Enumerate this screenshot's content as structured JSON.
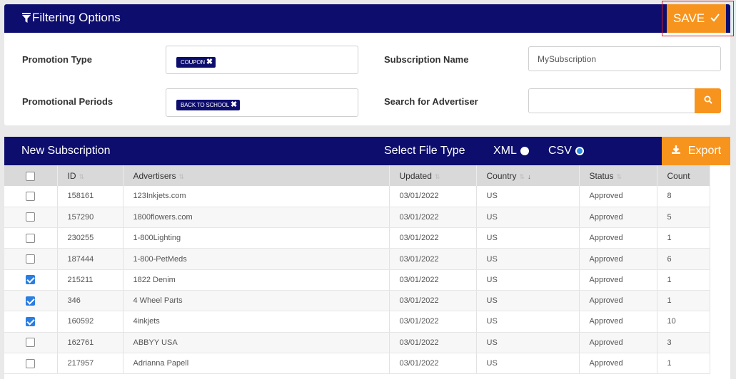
{
  "filter": {
    "title": "Filtering Options",
    "save_label": "SAVE",
    "promotion_type_label": "Promotion Type",
    "promotion_type_tags": [
      "COUPON"
    ],
    "promotional_periods_label": "Promotional Periods",
    "promotional_period_tags": [
      "BACK TO SCHOOL"
    ],
    "subscription_name_label": "Subscription Name",
    "subscription_name_value": "MySubscription",
    "search_advertiser_label": "Search for Advertiser",
    "search_advertiser_value": ""
  },
  "subscription": {
    "title": "New Subscription",
    "file_type_label": "Select File Type",
    "file_types": [
      {
        "label": "XML",
        "selected": false
      },
      {
        "label": "CSV",
        "selected": true
      }
    ],
    "export_label": "Export"
  },
  "table": {
    "columns": [
      "ID",
      "Advertisers",
      "Updated",
      "Country",
      "Status",
      "Count"
    ],
    "sorted_column": "Country",
    "rows": [
      {
        "checked": false,
        "id": "158161",
        "advertiser": "123Inkjets.com",
        "updated": "03/01/2022",
        "country": "US",
        "status": "Approved",
        "count": "8"
      },
      {
        "checked": false,
        "id": "157290",
        "advertiser": "1800flowers.com",
        "updated": "03/01/2022",
        "country": "US",
        "status": "Approved",
        "count": "5"
      },
      {
        "checked": false,
        "id": "230255",
        "advertiser": "1-800Lighting",
        "updated": "03/01/2022",
        "country": "US",
        "status": "Approved",
        "count": "1"
      },
      {
        "checked": false,
        "id": "187444",
        "advertiser": "1-800-PetMeds",
        "updated": "03/01/2022",
        "country": "US",
        "status": "Approved",
        "count": "6"
      },
      {
        "checked": true,
        "id": "215211",
        "advertiser": "1822 Denim",
        "updated": "03/01/2022",
        "country": "US",
        "status": "Approved",
        "count": "1"
      },
      {
        "checked": true,
        "id": "346",
        "advertiser": "4 Wheel Parts",
        "updated": "03/01/2022",
        "country": "US",
        "status": "Approved",
        "count": "1"
      },
      {
        "checked": true,
        "id": "160592",
        "advertiser": "4inkjets",
        "updated": "03/01/2022",
        "country": "US",
        "status": "Approved",
        "count": "10"
      },
      {
        "checked": false,
        "id": "162761",
        "advertiser": "ABBYY USA",
        "updated": "03/01/2022",
        "country": "US",
        "status": "Approved",
        "count": "3"
      },
      {
        "checked": false,
        "id": "217957",
        "advertiser": "Adrianna Papell",
        "updated": "03/01/2022",
        "country": "US",
        "status": "Approved",
        "count": "1"
      }
    ]
  },
  "colors": {
    "navy": "#0d0d6e",
    "orange": "#f7941d",
    "highlight": "#d8202a",
    "checkbox": "#2a7de1"
  }
}
